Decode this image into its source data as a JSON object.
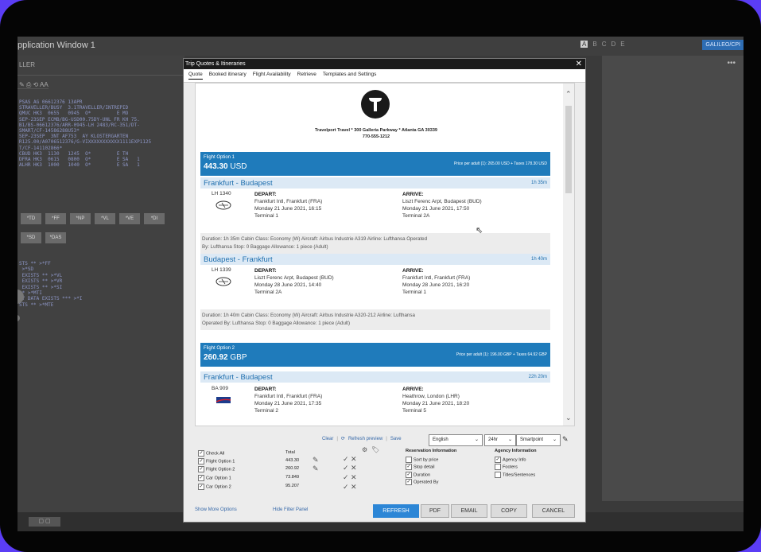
{
  "window": {
    "title": "pplication Window 1",
    "letters": [
      "A",
      "B",
      "C",
      "D",
      "E"
    ],
    "galileo": "GALILEO/CPI"
  },
  "terminal": {
    "header": "LLER",
    "icons": "✎ ⎙ ⟲ AA",
    "lines": "PSAS AG 06612376 13APR\nSTRAVELLER/BUSY  3.1TRAVELLER/INTREPID\nQMUC HK3  0655   0945  O*         E MO\nSEP-23SEP ECMB/BG-USD00.75DY-UNL FR KH 75.\nB1/BS-06612376/ARR-0945-LH 2483/RC-351/DT-\nSMART/CF-14586288U53*\nSEP-23SEP  3NT AF753  AY KLOSTERGARTEN\nR125.00/A0706512376/G-VIXXXXXXXXXXX1111EXP1125\nT/CF-141102866*\nCBUD HK3  1130   1245  O*         E TH\nDFRA HK3  0615   0800  O*         E SA   1\nALHR HK3  1000   1040  O*         E SA   1",
    "buttons_row1": [
      "*TD",
      "*FF",
      "*NP",
      "*VL",
      "*VE",
      "*DI"
    ],
    "buttons_row2": [
      "*SD",
      "*DAS"
    ],
    "commands": "STS ** >*FF\n >*SD\n EXISTS ** >*VL\n EXISTS ** >*VR\n EXISTS ** >*SI\n** >*MTI\nRY DATA EXISTS *** >*I\nSTS ** >*MTE"
  },
  "dialog": {
    "title": "Trip Quotes & Itineraries",
    "tabs": [
      "Quote",
      "Booked itinerary",
      "Flight Availability",
      "Retrieve",
      "Templates and Settings"
    ],
    "agency_line1": "Travelport Travel * 300 Galleria Parkway * Atlanta GA 30339",
    "agency_line2": "770-555-1212",
    "options": [
      {
        "label": "Flight Option 1",
        "amount": "443.30",
        "currency": "USD",
        "per_adult": "Price per adult (1): 265.00 USD + Taxes 178.30 USD",
        "legs": [
          {
            "route": "Frankfurt - Budapest",
            "duration": "1h 35m",
            "flight": "LH 1340",
            "depart_label": "DEPART:",
            "depart_airport": "Frankfurt Intl, Frankfurt (FRA)",
            "depart_time": "Monday 21 June 2021, 16:15",
            "depart_terminal": "Terminal 1",
            "arrive_label": "ARRIVE:",
            "arrive_airport": "Liszt Ferenc Arpt, Budapest (BUD)",
            "arrive_time": "Monday 21 June 2021, 17:50",
            "arrive_terminal": "Terminal 2A",
            "details1": "Duration: 1h 35m  Cabin Class: Economy (W)  Aircraft: Airbus Industrie A319  Airline: Lufthansa  Operated",
            "details2": "By: Lufthansa  Stop: 0  Baggage Allowance: 1 piece (Adult)"
          },
          {
            "route": "Budapest - Frankfurt",
            "duration": "1h 40m",
            "flight": "LH 1339",
            "depart_label": "DEPART:",
            "depart_airport": "Liszt Ferenc Arpt, Budapest (BUD)",
            "depart_time": "Monday 28 June 2021, 14:40",
            "depart_terminal": "Terminal 2A",
            "arrive_label": "ARRIVE:",
            "arrive_airport": "Frankfurt Intl, Frankfurt (FRA)",
            "arrive_time": "Monday 28 June 2021, 16:20",
            "arrive_terminal": "Terminal 1",
            "details1": "Duration: 1h 40m  Cabin Class: Economy (W)  Aircraft: Airbus Industrie A320-212  Airline: Lufthansa",
            "details2": "Operated By: Lufthansa  Stop: 0  Baggage Allowance: 1 piece (Adult)"
          }
        ]
      },
      {
        "label": "Flight Option 2",
        "amount": "260.92",
        "currency": "GBP",
        "per_adult": "Price per adult (1): 196.00 GBP + Taxes 64.92 GBP",
        "legs": [
          {
            "route": "Frankfurt - Budapest",
            "duration": "22h 20m",
            "flight": "BA 909",
            "depart_label": "DEPART:",
            "depart_airport": "Frankfurt Intl, Frankfurt (FRA)",
            "depart_time": "Monday 21 June 2021, 17:35",
            "depart_terminal": "Terminal 2",
            "arrive_label": "ARRIVE:",
            "arrive_airport": "Heathrow, London (LHR)",
            "arrive_time": "Monday 21 June 2021, 18:20",
            "arrive_terminal": "Terminal 5"
          }
        ]
      }
    ],
    "controls": {
      "clear": "Clear",
      "refresh_preview": "Refresh preview",
      "save": "Save",
      "language": "English",
      "time_format": "24hr",
      "template": "Smartpoint"
    },
    "filter": {
      "check_all": "Check All",
      "total": "Total",
      "rows": [
        {
          "label": "Flight Option 1",
          "total": "443.30"
        },
        {
          "label": "Flight Option 2",
          "total": "260.92"
        },
        {
          "label": "Car Option 1",
          "total": "73.849"
        },
        {
          "label": "Car Option 2",
          "total": "95.207"
        }
      ],
      "reservation_info": "Reservation Information",
      "res_items": [
        "Sort by price",
        "Stop detail",
        "Duration",
        "Operated By"
      ],
      "agency_info_title": "Agency Information",
      "agency_items": [
        "Agency Info",
        "Footers",
        "Titles/Sentences"
      ]
    },
    "footer": {
      "show_more": "Show More Options",
      "hide_filter": "Hide Filter Panel",
      "refresh": "REFRESH",
      "pdf": "PDF",
      "email": "EMAIL",
      "copy": "COPY",
      "cancel": "CANCEL"
    }
  }
}
